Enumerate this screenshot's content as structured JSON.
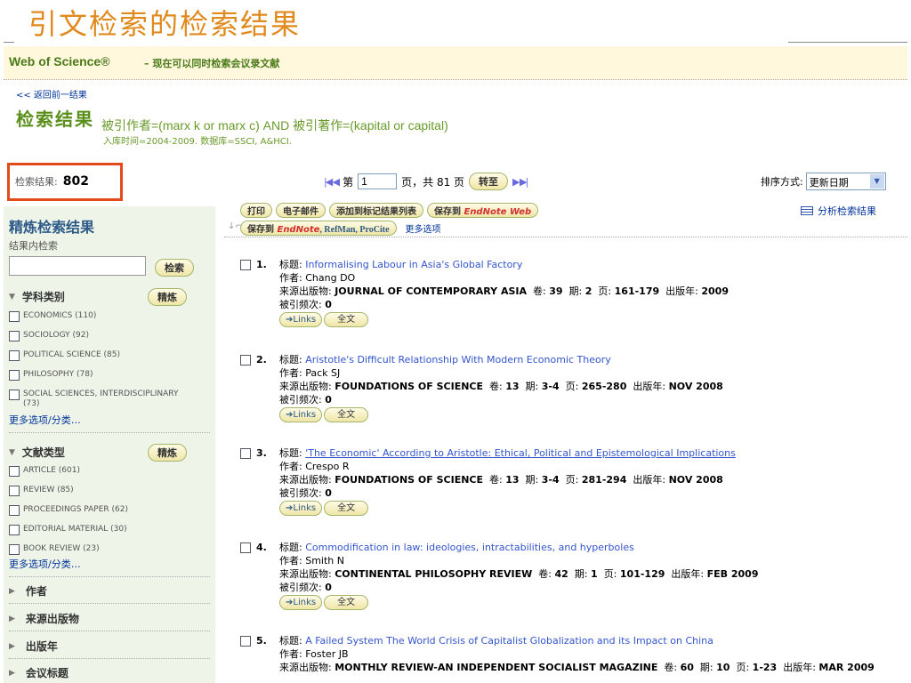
{
  "slide_title": "引文检索的检索结果",
  "wos": {
    "name": "Web of Science®",
    "tagline": "– 现在可以同时检索会议录文献"
  },
  "back_link": "<< 返回前一结果",
  "heading": "检索结果",
  "query": "被引作者=(marx k or marx c) AND 被引著作=(kapital or capital)",
  "query_sub": "入库时间=2004-2009. 数据库=SSCI, A&HCI.",
  "result_count": {
    "label": "检索结果:",
    "value": "802"
  },
  "pager": {
    "first_prev": "|◀ ◀",
    "page_label": "第",
    "page_value": "1",
    "total": "页，共 81 页",
    "go": "转至",
    "next_last": "▶ ▶|"
  },
  "sort": {
    "label": "排序方式:",
    "value": "更新日期"
  },
  "sidebar": {
    "title": "精炼检索结果",
    "within": "结果内检索",
    "search_btn": "检索",
    "refine_btn": "精炼",
    "subject": {
      "label": "学科类别",
      "items": [
        "ECONOMICS (110)",
        "SOCIOLOGY (92)",
        "POLITICAL SCIENCE (85)",
        "PHILOSOPHY (78)",
        "SOCIAL SCIENCES, INTERDISCIPLINARY (73)"
      ]
    },
    "doctype": {
      "label": "文献类型",
      "items": [
        "ARTICLE (601)",
        "REVIEW (85)",
        "PROCEEDINGS PAPER (62)",
        "EDITORIAL MATERIAL (30)",
        "BOOK REVIEW (23)"
      ]
    },
    "more": "更多选项/分类…",
    "collapsed": [
      "作者",
      "来源出版物",
      "出版年",
      "会议标题"
    ]
  },
  "toolbar": {
    "print": "打印",
    "email": "电子邮件",
    "marked": "添加到标记结果列表",
    "save_to": "保存到",
    "endnote_web": "EndNote Web",
    "save_to2": "保存到",
    "endnote": "EndNote",
    "refman": ", RefMan, ProCite",
    "more": "更多选项",
    "analyze": "分析检索结果"
  },
  "record_labels": {
    "title": "标题:",
    "author": "作者:",
    "source": "来源出版物:",
    "vol": "卷:",
    "issue": "期:",
    "pages": "页:",
    "year": "出版年:",
    "cited": "被引频次:",
    "links": "➔Links",
    "fulltext": "全文"
  },
  "records": [
    {
      "num": "1.",
      "title": "Informalising Labour in Asia's Global Factory",
      "author": "Chang DO",
      "source": "JOURNAL OF CONTEMPORARY ASIA",
      "vol": "39",
      "issue": "2",
      "pages": "161-179",
      "year": "2009",
      "cited": "0"
    },
    {
      "num": "2.",
      "title": "Aristotle's Difficult Relationship With Modern Economic Theory",
      "author": "Pack SJ",
      "source": "FOUNDATIONS OF SCIENCE",
      "vol": "13",
      "issue": "3-4",
      "pages": "265-280",
      "year": "NOV 2008",
      "cited": "0"
    },
    {
      "num": "3.",
      "title": "'The Economic' According to Aristotle: Ethical, Political and Epistemological Implications",
      "author": "Crespo R",
      "source": "FOUNDATIONS OF SCIENCE",
      "vol": "13",
      "issue": "3-4",
      "pages": "281-294",
      "year": "NOV 2008",
      "cited": "0"
    },
    {
      "num": "4.",
      "title": "Commodification in law: ideologies, intractabilities, and hyperboles",
      "author": "Smith N",
      "source": "CONTINENTAL PHILOSOPHY REVIEW",
      "vol": "42",
      "issue": "1",
      "pages": "101-129",
      "year": "FEB 2009",
      "cited": "0"
    },
    {
      "num": "5.",
      "title": "A Failed System The World Crisis of Capitalist Globalization and its Impact on China",
      "author": "Foster JB",
      "source": "MONTHLY REVIEW-AN INDEPENDENT SOCIALIST MAGAZINE",
      "vol": "60",
      "issue": "10",
      "pages": "1-23",
      "year": "MAR 2009"
    }
  ]
}
